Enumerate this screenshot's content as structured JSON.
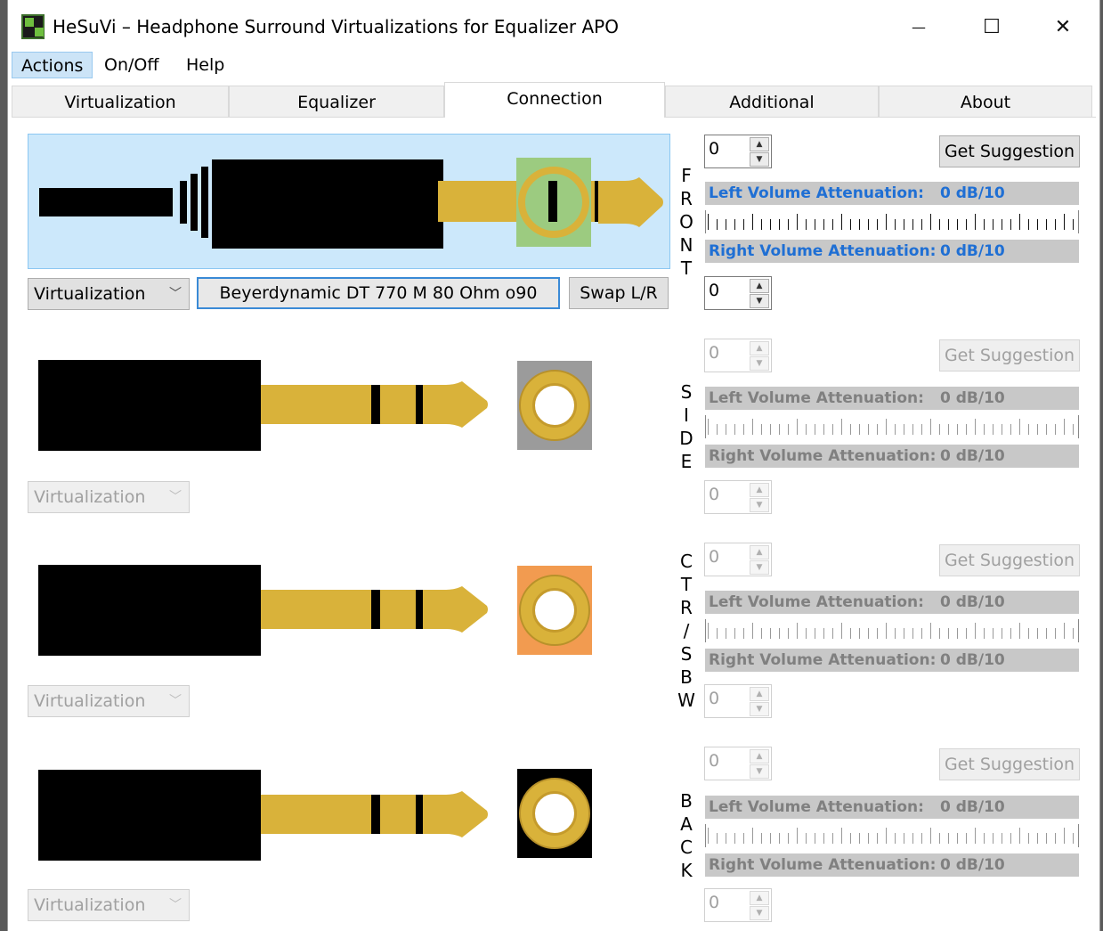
{
  "window": {
    "title": "HeSuVi – Headphone Surround Virtualizations for Equalizer APO",
    "minimize_glyph": "—",
    "maximize_glyph": "☐",
    "close_glyph": "✕"
  },
  "menu": [
    {
      "label": "Actions"
    },
    {
      "label": "On/Off"
    },
    {
      "label": "Help"
    }
  ],
  "tabs": [
    {
      "label": "Virtualization"
    },
    {
      "label": "Equalizer"
    },
    {
      "label": "Connection"
    },
    {
      "label": "Additional"
    },
    {
      "label": "About"
    }
  ],
  "selected_tab": "Connection",
  "colors": {
    "plug_gold": "#d9b23a",
    "front_socket_bg": "#9ccb80",
    "side_socket_bg": "#9b9b9b",
    "center_socket_bg": "#f29b50",
    "back_socket_bg": "#000000",
    "front_highlight": "#cce8fb",
    "label_blue": "#1f6fd4"
  },
  "channels": [
    {
      "id": "front",
      "vertical_label": [
        "F",
        "R",
        "O",
        "N",
        "T"
      ],
      "dropdown": "Virtualization",
      "hrir_name": "Beyerdynamic DT 770 M 80 Ohm o90",
      "swap_label": "Swap L/R",
      "top_spin": "0",
      "bottom_spin": "0",
      "suggest_label": "Get Suggestion",
      "left_label": "Left Volume Attenuation:",
      "left_value": "0 dB/10",
      "right_label": "Right Volume Attenuation:",
      "right_value": "0 dB/10",
      "enabled": true
    },
    {
      "id": "side",
      "vertical_label": [
        "S",
        "I",
        "D",
        "E"
      ],
      "dropdown": "Virtualization",
      "top_spin": "0",
      "bottom_spin": "0",
      "suggest_label": "Get Suggestion",
      "left_label": "Left Volume Attenuation:",
      "left_value": "0 dB/10",
      "right_label": "Right Volume Attenuation:",
      "right_value": "0 dB/10",
      "enabled": false
    },
    {
      "id": "ctr",
      "vertical_label": [
        "C",
        "T",
        "R",
        "/",
        "S",
        "B",
        "W"
      ],
      "dropdown": "Virtualization",
      "top_spin": "0",
      "bottom_spin": "0",
      "suggest_label": "Get Suggestion",
      "left_label": "Left Volume Attenuation:",
      "left_value": "0 dB/10",
      "right_label": "Right Volume Attenuation:",
      "right_value": "0 dB/10",
      "enabled": false
    },
    {
      "id": "back",
      "vertical_label": [
        "B",
        "A",
        "C",
        "K"
      ],
      "dropdown": "Virtualization",
      "top_spin": "0",
      "bottom_spin": "0",
      "suggest_label": "Get Suggestion",
      "left_label": "Left Volume Attenuation:",
      "left_value": "0 dB/10",
      "right_label": "Right Volume Attenuation:",
      "right_value": "0 dB/10",
      "enabled": false
    }
  ]
}
